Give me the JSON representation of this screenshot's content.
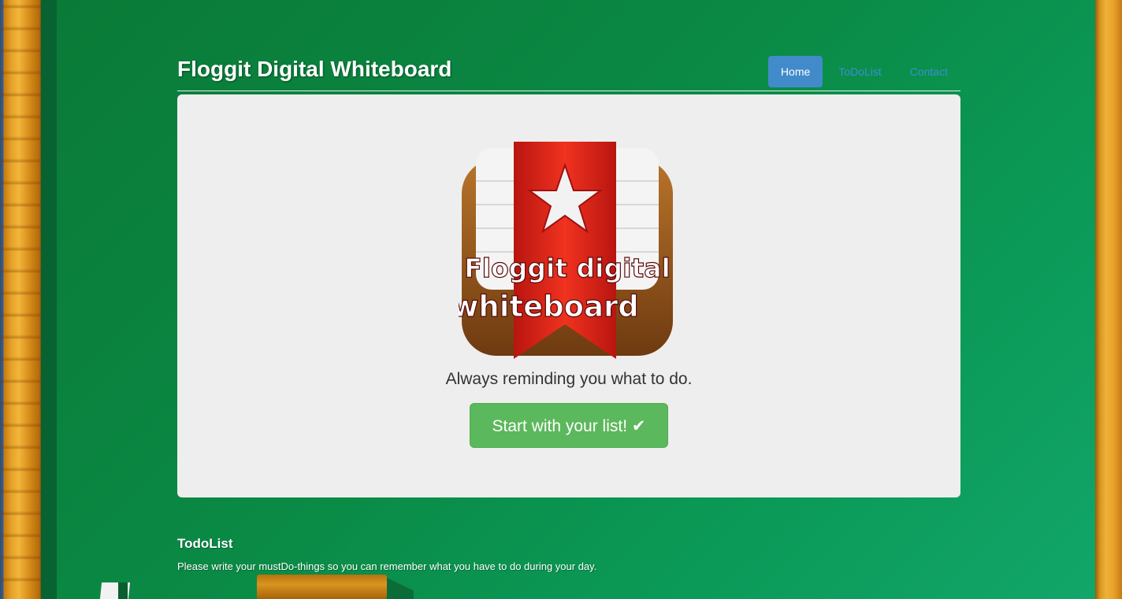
{
  "header": {
    "brand": "Floggit Digital Whiteboard",
    "nav": [
      {
        "label": "Home",
        "active": true
      },
      {
        "label": "ToDoList",
        "active": false
      },
      {
        "label": "Contact",
        "active": false
      }
    ]
  },
  "hero": {
    "logo_line1": "Floggit digital",
    "logo_line2": "whiteboard",
    "tagline": "Always reminding you what to do.",
    "cta_label": "Start with your list!",
    "cta_icon": "✔"
  },
  "todo_section": {
    "title": "TodoList",
    "description": "Please write your mustDo-things so you can remember what you have to do during your day."
  },
  "colors": {
    "board_green": "#0a8a45",
    "nav_active": "#428bca",
    "cta_green": "#5cb85c",
    "ribbon_red": "#e0241b"
  }
}
